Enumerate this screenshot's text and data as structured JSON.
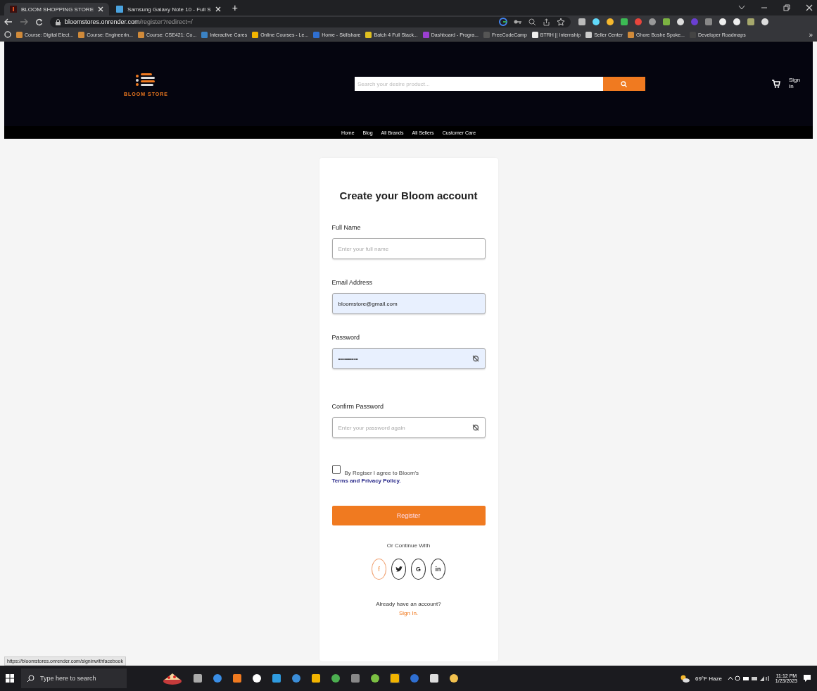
{
  "browser": {
    "tabs": [
      {
        "title": "BLOOM SHOPPING STORE",
        "selected": true
      },
      {
        "title": "Samsung Galaxy Note 10 - Full S",
        "selected": false
      }
    ],
    "new_tab": "+",
    "address": {
      "host": "bloomstores.onrender.com",
      "path": "/register?redirect=/"
    },
    "bookmarks": [
      "Course: Digital Elect...",
      "Course: Engineerin...",
      "Course: CSE421: Co...",
      "Interactive Cares",
      "Online Courses - Le...",
      "Home - Skillshare",
      "Batch 4 Full Stack...",
      "Dashboard - Progra...",
      "FreeCodeCamp",
      "BTRH || Internship",
      "Seller Center",
      "Ghore Boshe Spoke...",
      "Developer Roadmaps"
    ],
    "bookmarks_more": "»"
  },
  "site_header": {
    "logo": "BLOOM STORE",
    "search": {
      "placeholder": "Search your desire product..."
    },
    "sign_in": "Sign In",
    "nav": [
      "Home",
      "Blog",
      "All Brands",
      "All Sellers",
      "Customer Care"
    ]
  },
  "form": {
    "title": "Create your Bloom account",
    "fields": [
      {
        "label": "Full Name",
        "kind": "text",
        "placeholder": "Enter your full name",
        "autofilled": false
      },
      {
        "label": "Email Address",
        "kind": "text",
        "value": "bloomstore@gmail.com",
        "autofilled": true
      },
      {
        "label": "Password",
        "kind": "password",
        "value": "••••••••••",
        "autofilled": true
      },
      {
        "label": "Confirm Password",
        "kind": "password",
        "placeholder": "Enter your password again",
        "autofilled": false
      }
    ],
    "agree": {
      "checked": false,
      "text": "By Regiser I agree to Bloom's",
      "link": "Terms and Privacy Policy."
    },
    "register": "Register",
    "continue_with": "Or Continue With",
    "socials": [
      {
        "kind": "facebook",
        "glyph": "f",
        "hovered": true
      },
      {
        "kind": "twitter",
        "hovered": false
      },
      {
        "kind": "google",
        "glyph": "G",
        "hovered": false
      },
      {
        "kind": "linkedin",
        "glyph": "in",
        "hovered": false
      }
    ],
    "already": "Already have an account?",
    "sign_in_link": "Sign In."
  },
  "status_url": "https://bloomstores.onrender.com/signinwithfacebook",
  "taskbar": {
    "search_placeholder": "Type here to search",
    "weather": "69°F Haze",
    "time": "11:12 PM",
    "date": "1/23/2023"
  }
}
